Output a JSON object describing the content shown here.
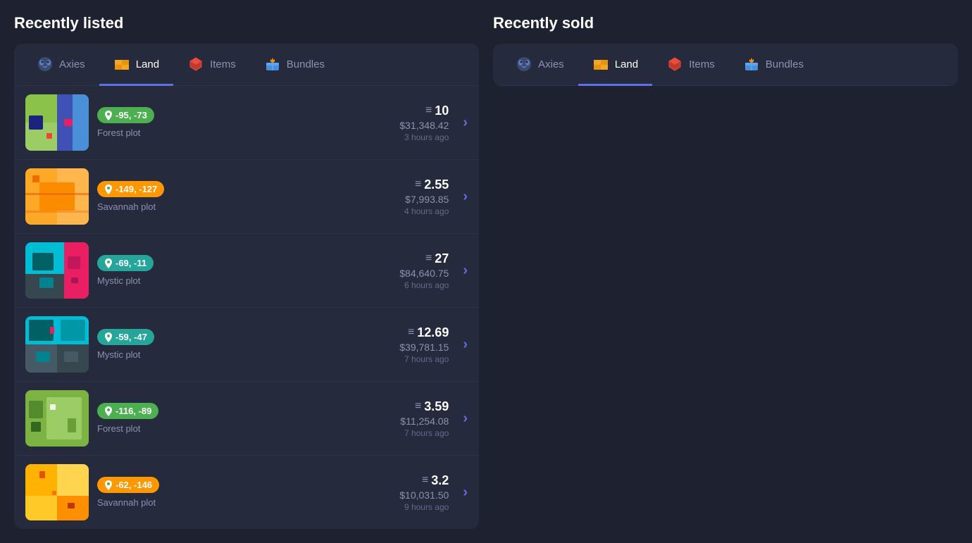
{
  "recently_listed": {
    "title": "Recently listed",
    "tabs": [
      {
        "id": "axies",
        "label": "Axies",
        "icon": "🐾",
        "active": false
      },
      {
        "id": "land",
        "label": "Land",
        "icon": "🟨",
        "active": true
      },
      {
        "id": "items",
        "label": "Items",
        "icon": "🏺",
        "active": false
      },
      {
        "id": "bundles",
        "label": "Bundles",
        "icon": "🎁",
        "active": false
      }
    ],
    "listings": [
      {
        "id": 1,
        "coords": "-95, -73",
        "badge_color": "green",
        "land_type": "Forest plot",
        "eth_price": "10",
        "usd_price": "$31,348.42",
        "time_ago": "3 hours ago",
        "thumb_type": "forest1"
      },
      {
        "id": 2,
        "coords": "-149, -127",
        "badge_color": "orange",
        "land_type": "Savannah plot",
        "eth_price": "2.55",
        "usd_price": "$7,993.85",
        "time_ago": "4 hours ago",
        "thumb_type": "savannah1"
      },
      {
        "id": 3,
        "coords": "-69, -11",
        "badge_color": "cyan",
        "land_type": "Mystic plot",
        "eth_price": "27",
        "usd_price": "$84,640.75",
        "time_ago": "6 hours ago",
        "thumb_type": "mystic1"
      },
      {
        "id": 4,
        "coords": "-59, -47",
        "badge_color": "cyan",
        "land_type": "Mystic plot",
        "eth_price": "12.69",
        "usd_price": "$39,781.15",
        "time_ago": "7 hours ago",
        "thumb_type": "mystic2"
      },
      {
        "id": 5,
        "coords": "-116, -89",
        "badge_color": "green",
        "land_type": "Forest plot",
        "eth_price": "3.59",
        "usd_price": "$11,254.08",
        "time_ago": "7 hours ago",
        "thumb_type": "forest2"
      },
      {
        "id": 6,
        "coords": "-62, -146",
        "badge_color": "orange",
        "land_type": "Savannah plot",
        "eth_price": "3.2",
        "usd_price": "$10,031.50",
        "time_ago": "9 hours ago",
        "thumb_type": "savannah2"
      }
    ]
  },
  "recently_sold": {
    "title": "Recently sold",
    "tabs": [
      {
        "id": "axies",
        "label": "Axies",
        "icon": "🐾",
        "active": false
      },
      {
        "id": "land",
        "label": "Land",
        "icon": "🟨",
        "active": true
      },
      {
        "id": "items",
        "label": "Items",
        "icon": "🏺",
        "active": false
      },
      {
        "id": "bundles",
        "label": "Bundles",
        "icon": "🎁",
        "active": false
      }
    ]
  },
  "icons": {
    "axie": "🐾",
    "land": "🟨",
    "items": "🏺",
    "bundles": "🎁",
    "pin": "📍",
    "eth": "≡",
    "chevron_right": "›"
  }
}
